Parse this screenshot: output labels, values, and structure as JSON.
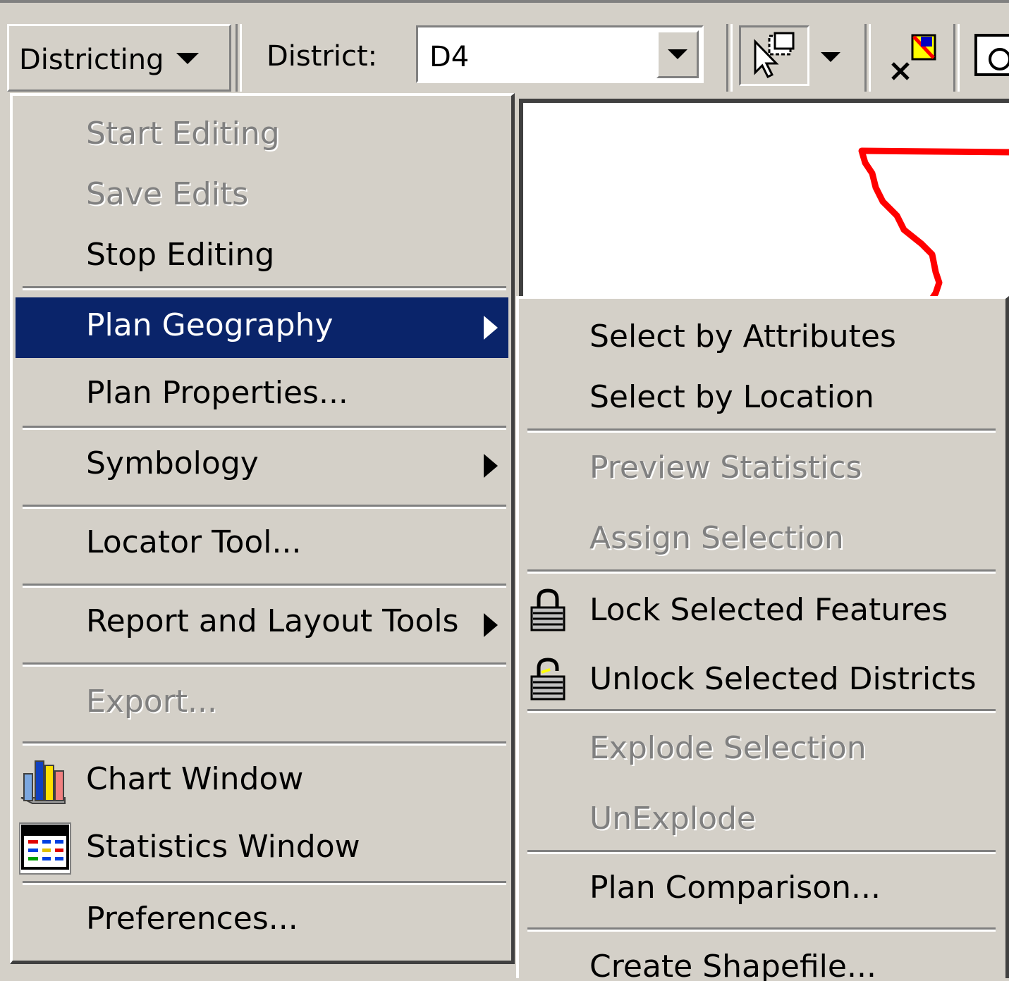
{
  "toolbar": {
    "districting_label": "Districting",
    "district_label": "District:",
    "district_value": "D4",
    "select_tool_icon": "select-pointer-icon",
    "clear_selection_icon": "clear-selection-icon",
    "extra_tool_icon": "zoom-tool-icon"
  },
  "main_menu": {
    "items": [
      {
        "label": "Start Editing",
        "enabled": false
      },
      {
        "label": "Save Edits",
        "enabled": false
      },
      {
        "label": "Stop Editing",
        "enabled": true
      },
      {
        "label": "Plan Geography",
        "enabled": true,
        "highlighted": true,
        "submenu": true
      },
      {
        "label": "Plan Properties...",
        "enabled": true
      },
      {
        "label": "Symbology",
        "enabled": true,
        "submenu": true
      },
      {
        "label": "Locator Tool...",
        "enabled": true
      },
      {
        "label": "Report and Layout Tools",
        "enabled": true,
        "submenu": true
      },
      {
        "label": "Export...",
        "enabled": false
      },
      {
        "label": "Chart Window",
        "enabled": true,
        "icon": "chart-icon"
      },
      {
        "label": "Statistics Window",
        "enabled": true,
        "icon": "statistics-icon"
      },
      {
        "label": "Preferences...",
        "enabled": true
      }
    ]
  },
  "sub_menu": {
    "items": [
      {
        "label": "Select by Attributes",
        "enabled": true
      },
      {
        "label": "Select by Location",
        "enabled": true
      },
      {
        "label": "Preview Statistics",
        "enabled": false
      },
      {
        "label": "Assign Selection",
        "enabled": false
      },
      {
        "label": "Lock Selected Features",
        "enabled": true,
        "icon": "lock-icon"
      },
      {
        "label": "Unlock Selected Districts",
        "enabled": true,
        "icon": "unlock-icon"
      },
      {
        "label": "Explode Selection",
        "enabled": false
      },
      {
        "label": "UnExplode",
        "enabled": false
      },
      {
        "label": "Plan Comparison...",
        "enabled": true
      },
      {
        "label": "Create Shapefile...",
        "enabled": true
      }
    ]
  },
  "colors": {
    "menu_bg": "#d4d0c8",
    "highlight": "#0a246a",
    "district_boundary": "#ff0000"
  }
}
